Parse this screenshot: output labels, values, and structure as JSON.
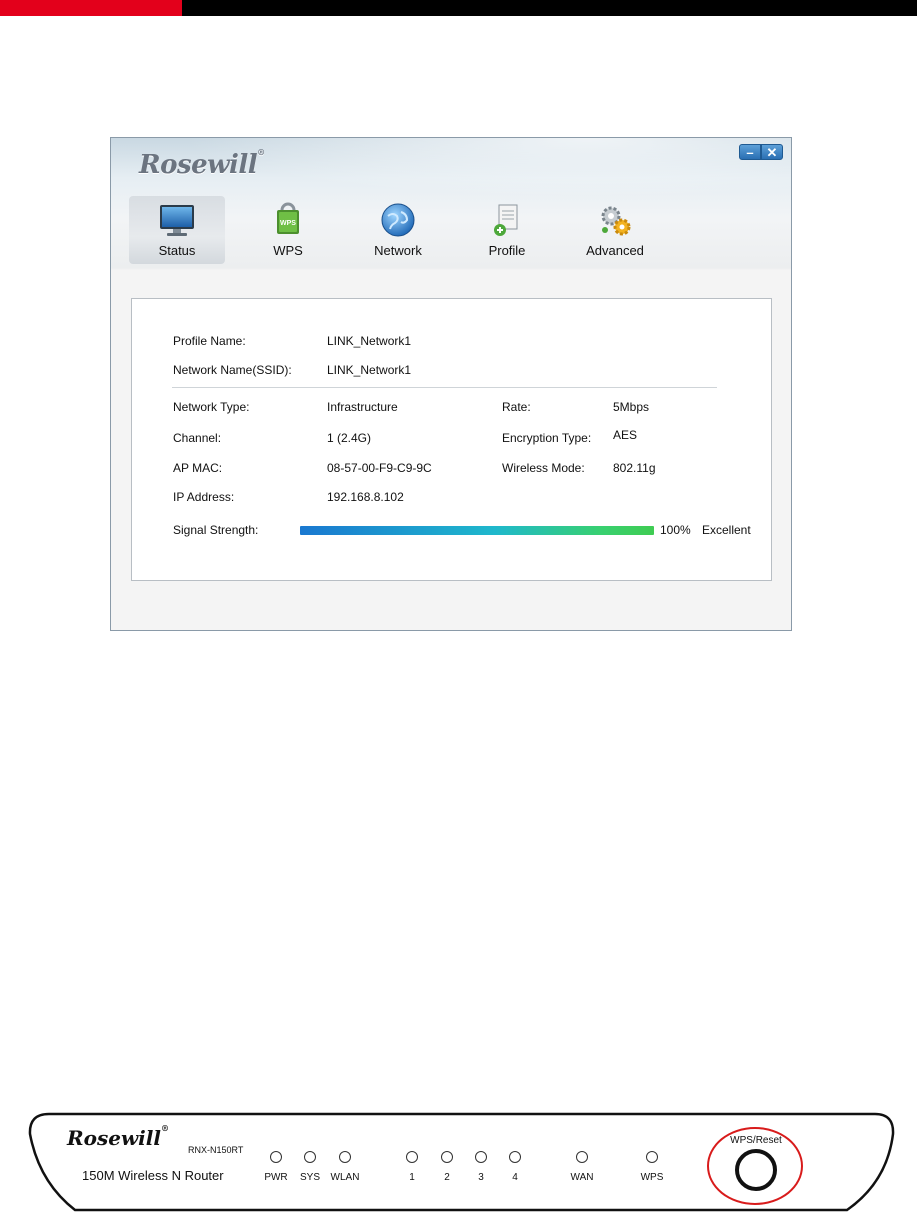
{
  "window": {
    "brand": "Rosewill",
    "brand_mark": "®",
    "minimize_icon": "minimize-icon",
    "close_icon": "close-icon",
    "tabs": [
      {
        "label": "Status",
        "icon": "monitor-icon",
        "active": true
      },
      {
        "label": "WPS",
        "icon": "wps-icon",
        "active": false
      },
      {
        "label": "Network",
        "icon": "globe-icon",
        "active": false
      },
      {
        "label": "Profile",
        "icon": "profile-icon",
        "active": false
      },
      {
        "label": "Advanced",
        "icon": "gears-icon",
        "active": false
      }
    ]
  },
  "status": {
    "profile_name_label": "Profile Name:",
    "profile_name": "LINK_Network1",
    "ssid_label": "Network Name(SSID):",
    "ssid": "LINK_Network1",
    "network_type_label": "Network Type:",
    "network_type": "Infrastructure",
    "rate_label": "Rate:",
    "rate": "5Mbps",
    "channel_label": "Channel:",
    "channel": "1 (2.4G)",
    "encryption_label": "Encryption Type:",
    "encryption": "AES",
    "ap_mac_label": "AP MAC:",
    "ap_mac": "08-57-00-F9-C9-9C",
    "wireless_mode_label": "Wireless Mode:",
    "wireless_mode": "802.11g",
    "ip_label": "IP Address:",
    "ip": "192.168.8.102",
    "signal_label": "Signal Strength:",
    "signal_percent": "100%",
    "signal_quality": "Excellent",
    "signal_level": 1.0
  },
  "router": {
    "brand": "Rosewill",
    "brand_mark": "®",
    "model": "RNX-N150RT",
    "name": "150M Wireless N Router",
    "leds": [
      "PWR",
      "SYS",
      "WLAN",
      "1",
      "2",
      "3",
      "4",
      "WAN",
      "WPS"
    ],
    "wps_reset_label": "WPS/Reset",
    "highlight_color": "#d81b1b"
  },
  "colors": {
    "top_bar_red": "#e3001b",
    "top_bar_black": "#000000",
    "signal_start": "#1a78d0",
    "signal_end": "#3fcc52"
  }
}
